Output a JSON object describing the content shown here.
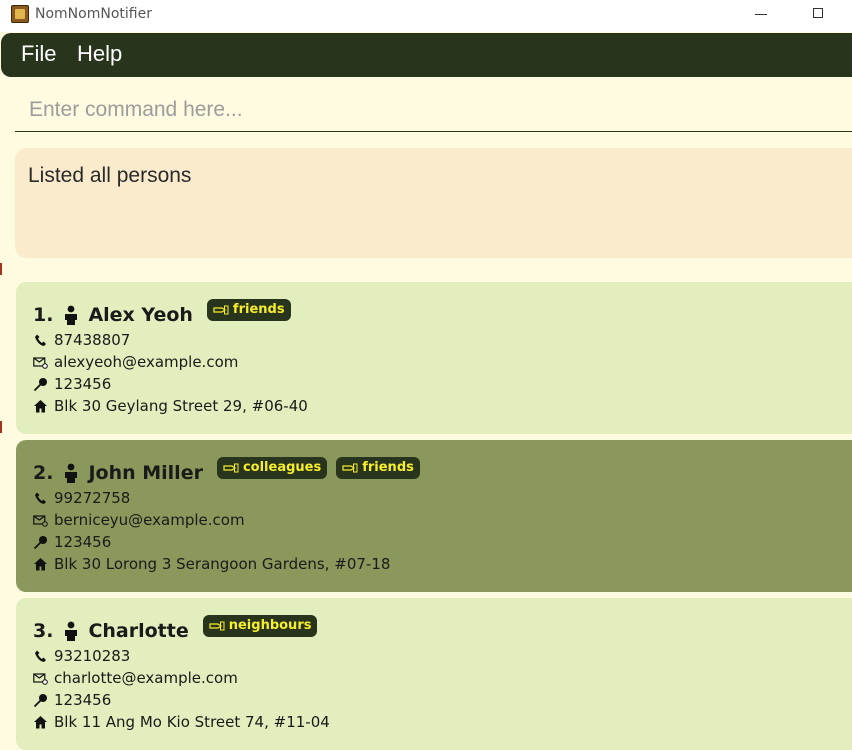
{
  "window": {
    "title": "NomNomNotifier",
    "icon": "app-icon"
  },
  "menu": {
    "file": "File",
    "help": "Help"
  },
  "command": {
    "placeholder": "Enter command here...",
    "value": ""
  },
  "result": {
    "message": "Listed all persons"
  },
  "persons": [
    {
      "index": "1.",
      "name": "Alex Yeoh",
      "tags": [
        "friends"
      ],
      "phone": "87438807",
      "email": "alexyeoh@example.com",
      "postal": "123456",
      "address": "Blk 30 Geylang Street 29, #06-40"
    },
    {
      "index": "2.",
      "name": "John Miller",
      "tags": [
        "colleagues",
        "friends"
      ],
      "phone": "99272758",
      "email": "berniceyu@example.com",
      "postal": "123456",
      "address": "Blk 30 Lorong 3 Serangoon Gardens, #07-18"
    },
    {
      "index": "3.",
      "name": "Charlotte",
      "tags": [
        "neighbours"
      ],
      "phone": "93210283",
      "email": "charlotte@example.com",
      "postal": "123456",
      "address": "Blk 11 Ang Mo Kio Street 74, #11-04"
    }
  ],
  "colors": {
    "background": "#fffbe0",
    "menubar": "#28341b",
    "result_box": "#faebcd",
    "card": "#e2eebd",
    "card_selected": "#8b985b",
    "tag_bg": "#28341b",
    "tag_text": "#f6ee28"
  }
}
